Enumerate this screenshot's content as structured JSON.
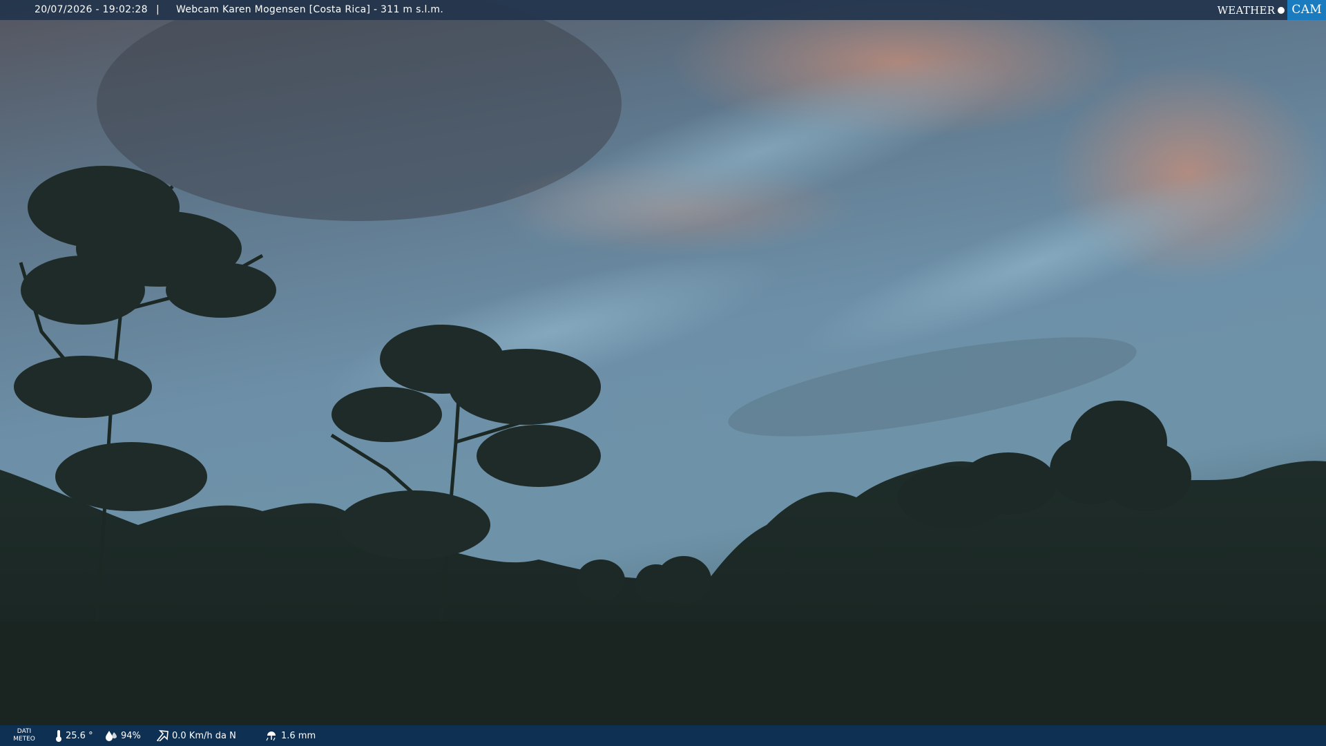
{
  "header": {
    "datetime": "20/07/2026 - 19:02:28",
    "separator": "|",
    "caption": "Webcam Karen Mogensen [Costa Rica]  - 311 m s.l.m."
  },
  "logo": {
    "part1": "WEATHER",
    "part2": "CAM"
  },
  "footer": {
    "label_line1": "DATI",
    "label_line2": "METEO",
    "temperature": "25.6 °",
    "humidity": "94%",
    "wind": "0.0 Km/h da N",
    "rain": "1.6 mm"
  },
  "icons": {
    "temperature": "thermometer-icon",
    "humidity": "humidity-icon",
    "wind": "wind-icon",
    "rain": "rain-icon"
  },
  "colors": {
    "top_bar": "#22344c",
    "bottom_bar": "#0e3256",
    "logo_accent": "#1b7bbf"
  }
}
